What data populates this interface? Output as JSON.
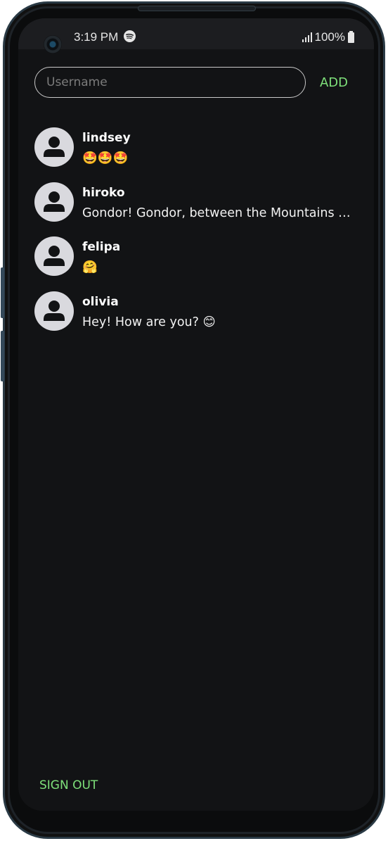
{
  "status_bar": {
    "time": "3:19 PM",
    "battery": "100%",
    "icons": [
      "camera-icon",
      "spotify-icon",
      "signal-icon",
      "battery-icon"
    ]
  },
  "add_row": {
    "placeholder": "Username",
    "value": "",
    "add_label": "ADD"
  },
  "chats": [
    {
      "name": "lindsey",
      "message": "🤩🤩🤩"
    },
    {
      "name": "hiroko",
      "message": "Gondor! Gondor, between the Mountains and the Sea!"
    },
    {
      "name": "felipa",
      "message": "🤗"
    },
    {
      "name": "olivia",
      "message": "Hey! How are you? 😊"
    }
  ],
  "footer": {
    "signout_label": "SIGN OUT"
  },
  "colors": {
    "accent": "#7ee07a",
    "background": "#121315",
    "avatar": "#d9d9de"
  }
}
